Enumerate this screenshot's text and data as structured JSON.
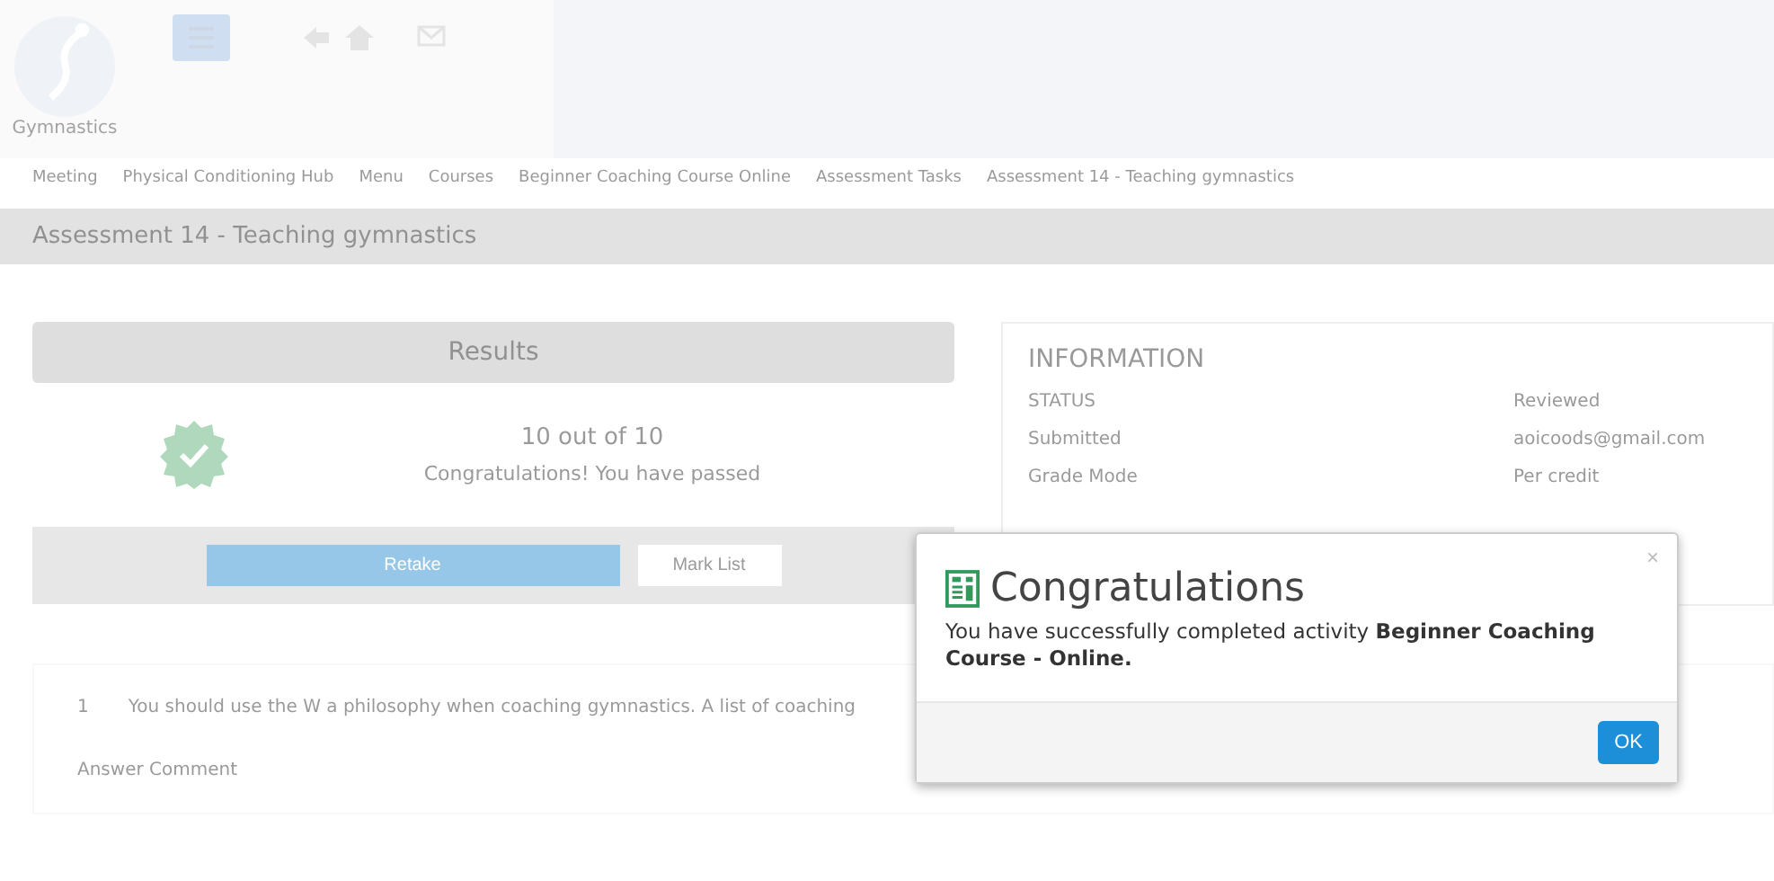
{
  "header": {
    "logo_text": "Gymnastics"
  },
  "breadcrumb": [
    {
      "label": "Meeting"
    },
    {
      "label": "Physical Conditioning Hub"
    },
    {
      "label": "Menu"
    },
    {
      "label": "Courses"
    },
    {
      "label": "Beginner Coaching Course Online"
    },
    {
      "label": "Assessment Tasks"
    },
    {
      "label": "Assessment 14 - Teaching gymnastics"
    }
  ],
  "page_title": "Assessment 14 - Teaching gymnastics",
  "results": {
    "title": "Results",
    "score": "10 out of 10",
    "message": "Congratulations! You have passed",
    "buttons": [
      {
        "label": "Retake",
        "kind": "primary"
      },
      {
        "label": "Mark List",
        "kind": "secondary"
      }
    ]
  },
  "information": {
    "title": "INFORMATION",
    "rows": [
      {
        "label": "STATUS",
        "value": "Reviewed"
      },
      {
        "label": "Submitted",
        "value": "aoicoods@gmail.com"
      },
      {
        "label": "Grade Mode",
        "value": "Per credit"
      }
    ]
  },
  "question": {
    "number": "1",
    "text": "You should use the W a philosophy when coaching gymnastics. A list of coaching",
    "answer_label": "Answer Comment"
  },
  "modal": {
    "title": "Congratulations",
    "message": "You have successfully completed activity **Beginner Coaching Course - Online.**",
    "close": "×",
    "button": "OK"
  }
}
